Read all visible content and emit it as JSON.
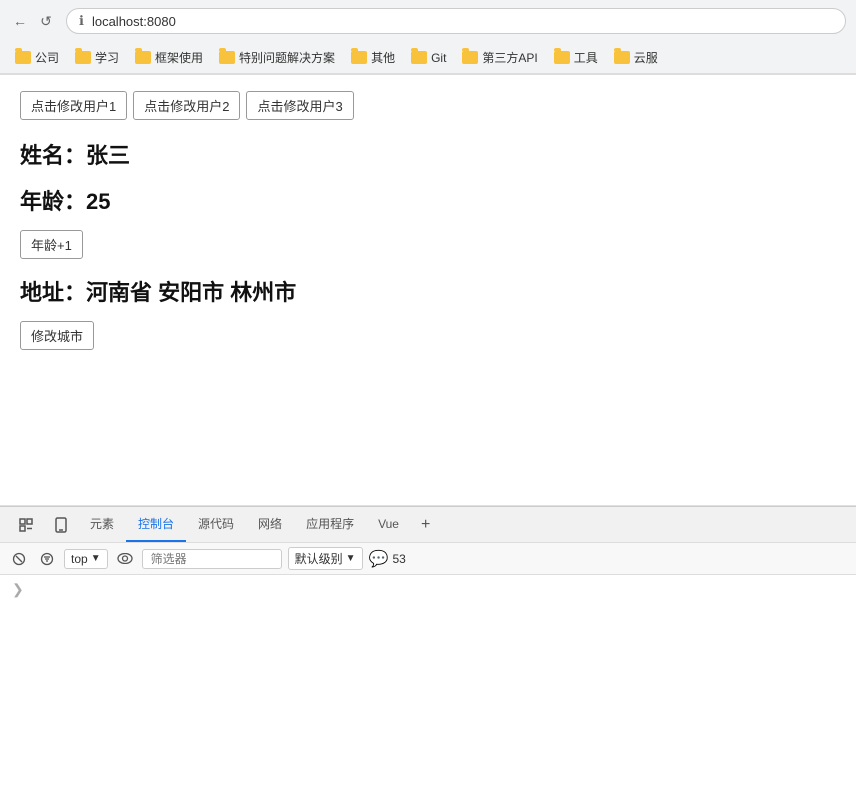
{
  "browser": {
    "url": "localhost:8080",
    "back_btn": "←",
    "reload_btn": "↺",
    "info_icon": "ℹ"
  },
  "bookmarks": [
    {
      "label": "公司"
    },
    {
      "label": "学习"
    },
    {
      "label": "框架使用"
    },
    {
      "label": "特别问题解决方案"
    },
    {
      "label": "其他"
    },
    {
      "label": "Git"
    },
    {
      "label": "第三方API"
    },
    {
      "label": "工具"
    },
    {
      "label": "云服"
    }
  ],
  "user_buttons": [
    {
      "label": "点击修改用户1"
    },
    {
      "label": "点击修改用户2"
    },
    {
      "label": "点击修改用户3"
    }
  ],
  "user_info": {
    "name_label": "姓名：张三",
    "age_label": "年龄：25",
    "age_btn": "年龄+1",
    "address_label": "地址：河南省 安阳市 林州市",
    "address_btn": "修改城市"
  },
  "devtools": {
    "tabs": [
      "元素",
      "控制台",
      "源代码",
      "网络",
      "应用程序",
      "Vue"
    ],
    "active_tab": "控制台",
    "toolbar": {
      "top_label": "top",
      "filter_placeholder": "筛选器",
      "level_label": "默认级别",
      "message_count": "53"
    }
  }
}
